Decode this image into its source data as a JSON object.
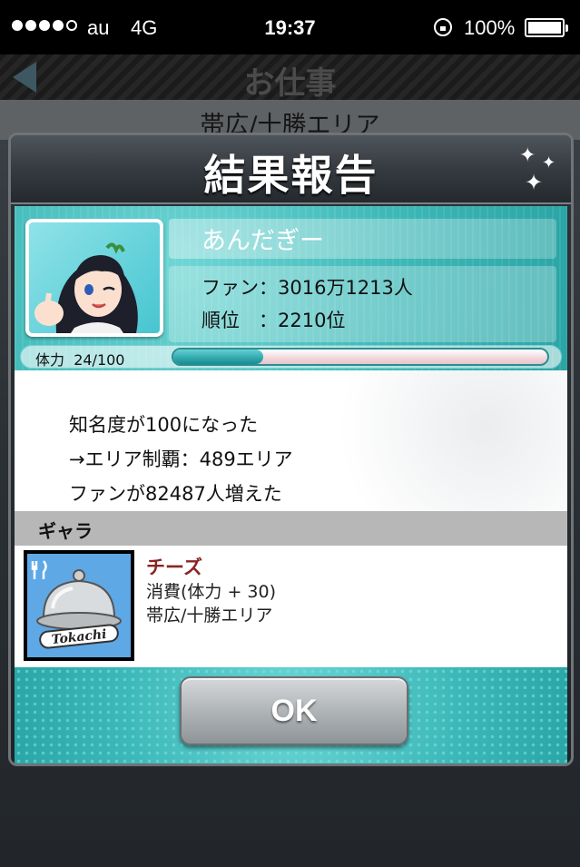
{
  "status_bar": {
    "carrier": "au",
    "network": "4G",
    "time": "19:37",
    "battery": "100%",
    "signal_bars_filled": 4,
    "signal_bars_total": 5
  },
  "app_header": {
    "title": "お仕事",
    "area": "帯広/十勝エリア"
  },
  "modal": {
    "title": "結果報告",
    "profile": {
      "name": "あんだぎー",
      "fans": "ファン：3016万1213人",
      "rank": "順位　：2210位",
      "stamina_label": "体力",
      "stamina_value": "24/100",
      "stamina_fraction": 0.24
    },
    "result_lines": [
      "知名度が100になった",
      "→エリア制覇：489エリア",
      "ファンが82487人増えた"
    ],
    "gala": {
      "header": "ギャラ",
      "item": {
        "name": "チーズ",
        "cost": "消費(体力 + 30)",
        "area": "帯広/十勝エリア",
        "icon_caption": "Tokachi"
      }
    },
    "ok_label": "OK"
  },
  "colors": {
    "teal": "#3db8b7",
    "item_name": "#8a2424",
    "gala_header": "#b7b7b7"
  }
}
